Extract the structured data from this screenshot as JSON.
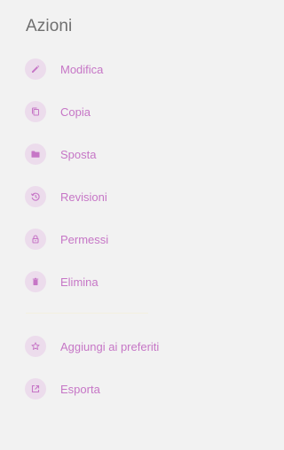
{
  "header": {
    "title": "Azioni"
  },
  "colors": {
    "background": "#f2f2f2",
    "title": "#6f6f6f",
    "accent": "#c676c6",
    "icon_bg": "#ecdcec",
    "divider": "#f3f0e0"
  },
  "menu": {
    "items": [
      {
        "label": "Modifica",
        "icon": "pencil-icon"
      },
      {
        "label": "Copia",
        "icon": "copy-icon"
      },
      {
        "label": "Sposta",
        "icon": "folder-icon"
      },
      {
        "label": "Revisioni",
        "icon": "history-icon"
      },
      {
        "label": "Permessi",
        "icon": "lock-icon"
      },
      {
        "label": "Elimina",
        "icon": "trash-icon"
      }
    ],
    "secondary_items": [
      {
        "label": "Aggiungi ai preferiti",
        "icon": "star-icon"
      },
      {
        "label": "Esporta",
        "icon": "external-link-icon"
      }
    ]
  }
}
